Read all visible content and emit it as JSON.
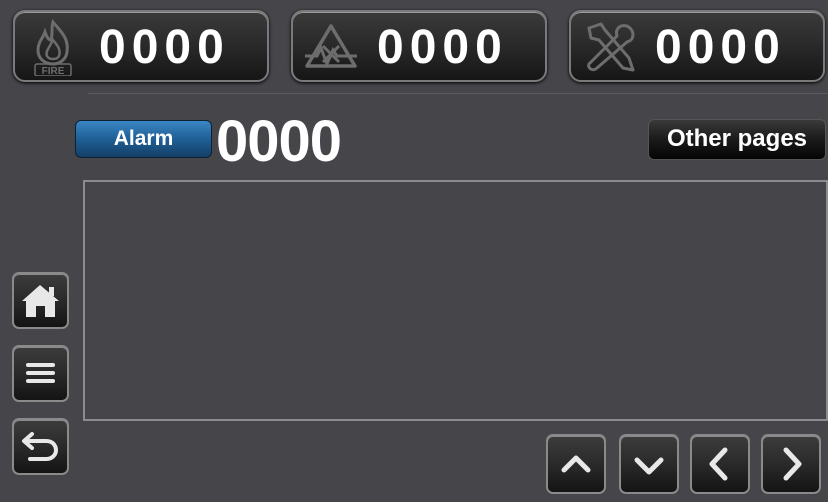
{
  "counters": {
    "fire": {
      "icon": "fire-icon",
      "value": "0000",
      "icon_text": "FIRE"
    },
    "fault": {
      "icon": "fault-icon",
      "value": "0000"
    },
    "maintenance": {
      "icon": "wrench-screwdriver-icon",
      "value": "0000"
    }
  },
  "alarm": {
    "label": "Alarm",
    "count": "0000"
  },
  "other_pages": {
    "label": "Other pages"
  },
  "sidebar": [
    {
      "icon": "home-icon"
    },
    {
      "icon": "menu-icon"
    },
    {
      "icon": "back-icon"
    }
  ],
  "nav": [
    {
      "icon": "chevron-up-icon"
    },
    {
      "icon": "chevron-down-icon"
    },
    {
      "icon": "chevron-left-icon"
    },
    {
      "icon": "chevron-right-icon"
    }
  ]
}
